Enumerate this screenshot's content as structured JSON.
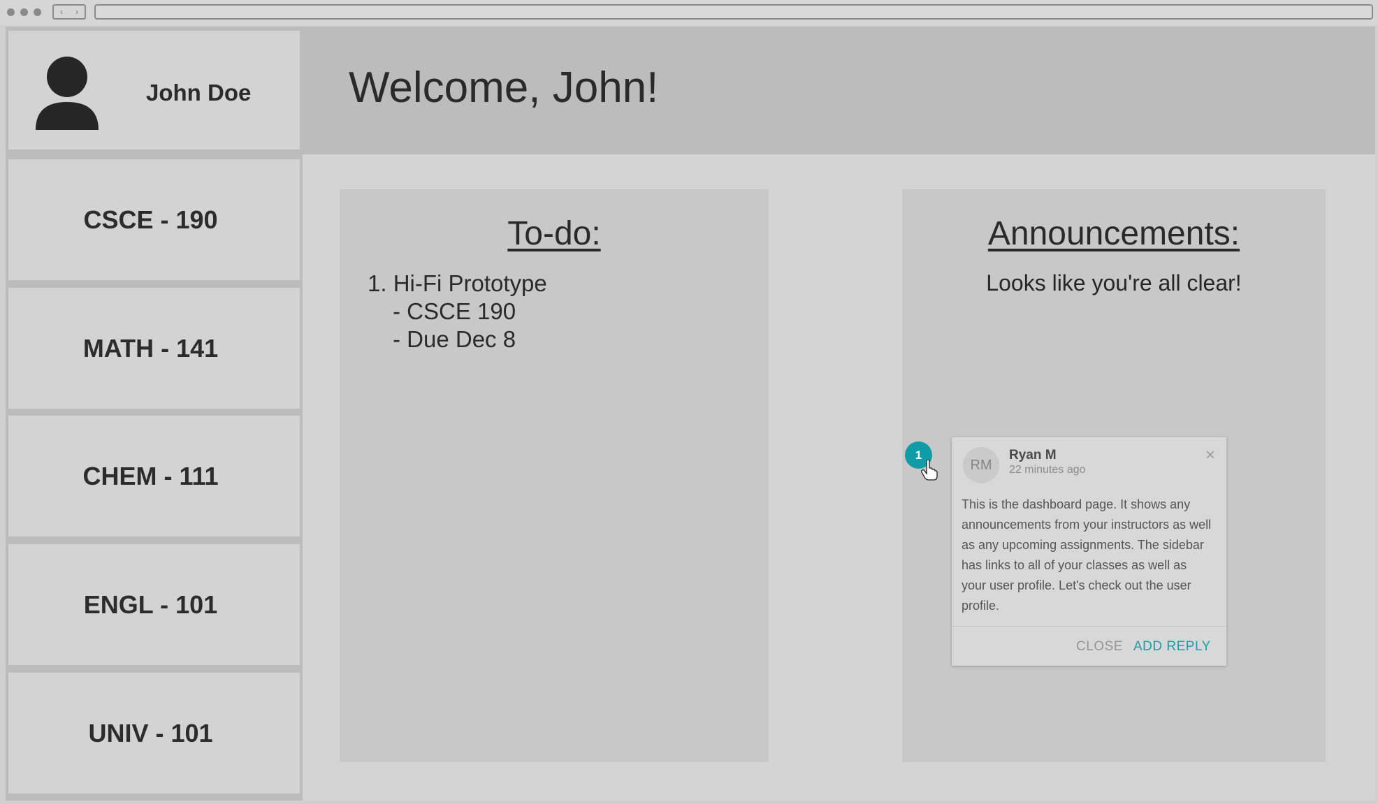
{
  "browser": {
    "back_glyph": "‹",
    "forward_glyph": "›"
  },
  "user": {
    "name": "John Doe",
    "avatar_icon": "user-silhouette-icon"
  },
  "header": {
    "welcome": "Welcome, John!"
  },
  "sidebar": {
    "courses": [
      "CSCE - 190",
      "MATH - 141",
      "CHEM - 111",
      "ENGL - 101",
      "UNIV - 101"
    ]
  },
  "todo": {
    "title": "To-do:",
    "items": [
      {
        "line": "1. Hi-Fi Prototype",
        "details": [
          "- CSCE 190",
          "- Due Dec 8"
        ]
      }
    ]
  },
  "announcements": {
    "title": "Announcements:",
    "empty_message": "Looks like you're all clear!"
  },
  "comment": {
    "badge_number": "1",
    "initials": "RM",
    "author": "Ryan M",
    "time": "22 minutes ago",
    "text": "This is the dashboard page. It shows any announcements from your instructors as well as any upcoming assignments. The sidebar has links to all of your classes as well as your user profile. Let's check out the user profile.",
    "close_label": "CLOSE",
    "reply_label": "ADD REPLY",
    "close_glyph": "×",
    "accent_color": "#0f9ca6"
  }
}
